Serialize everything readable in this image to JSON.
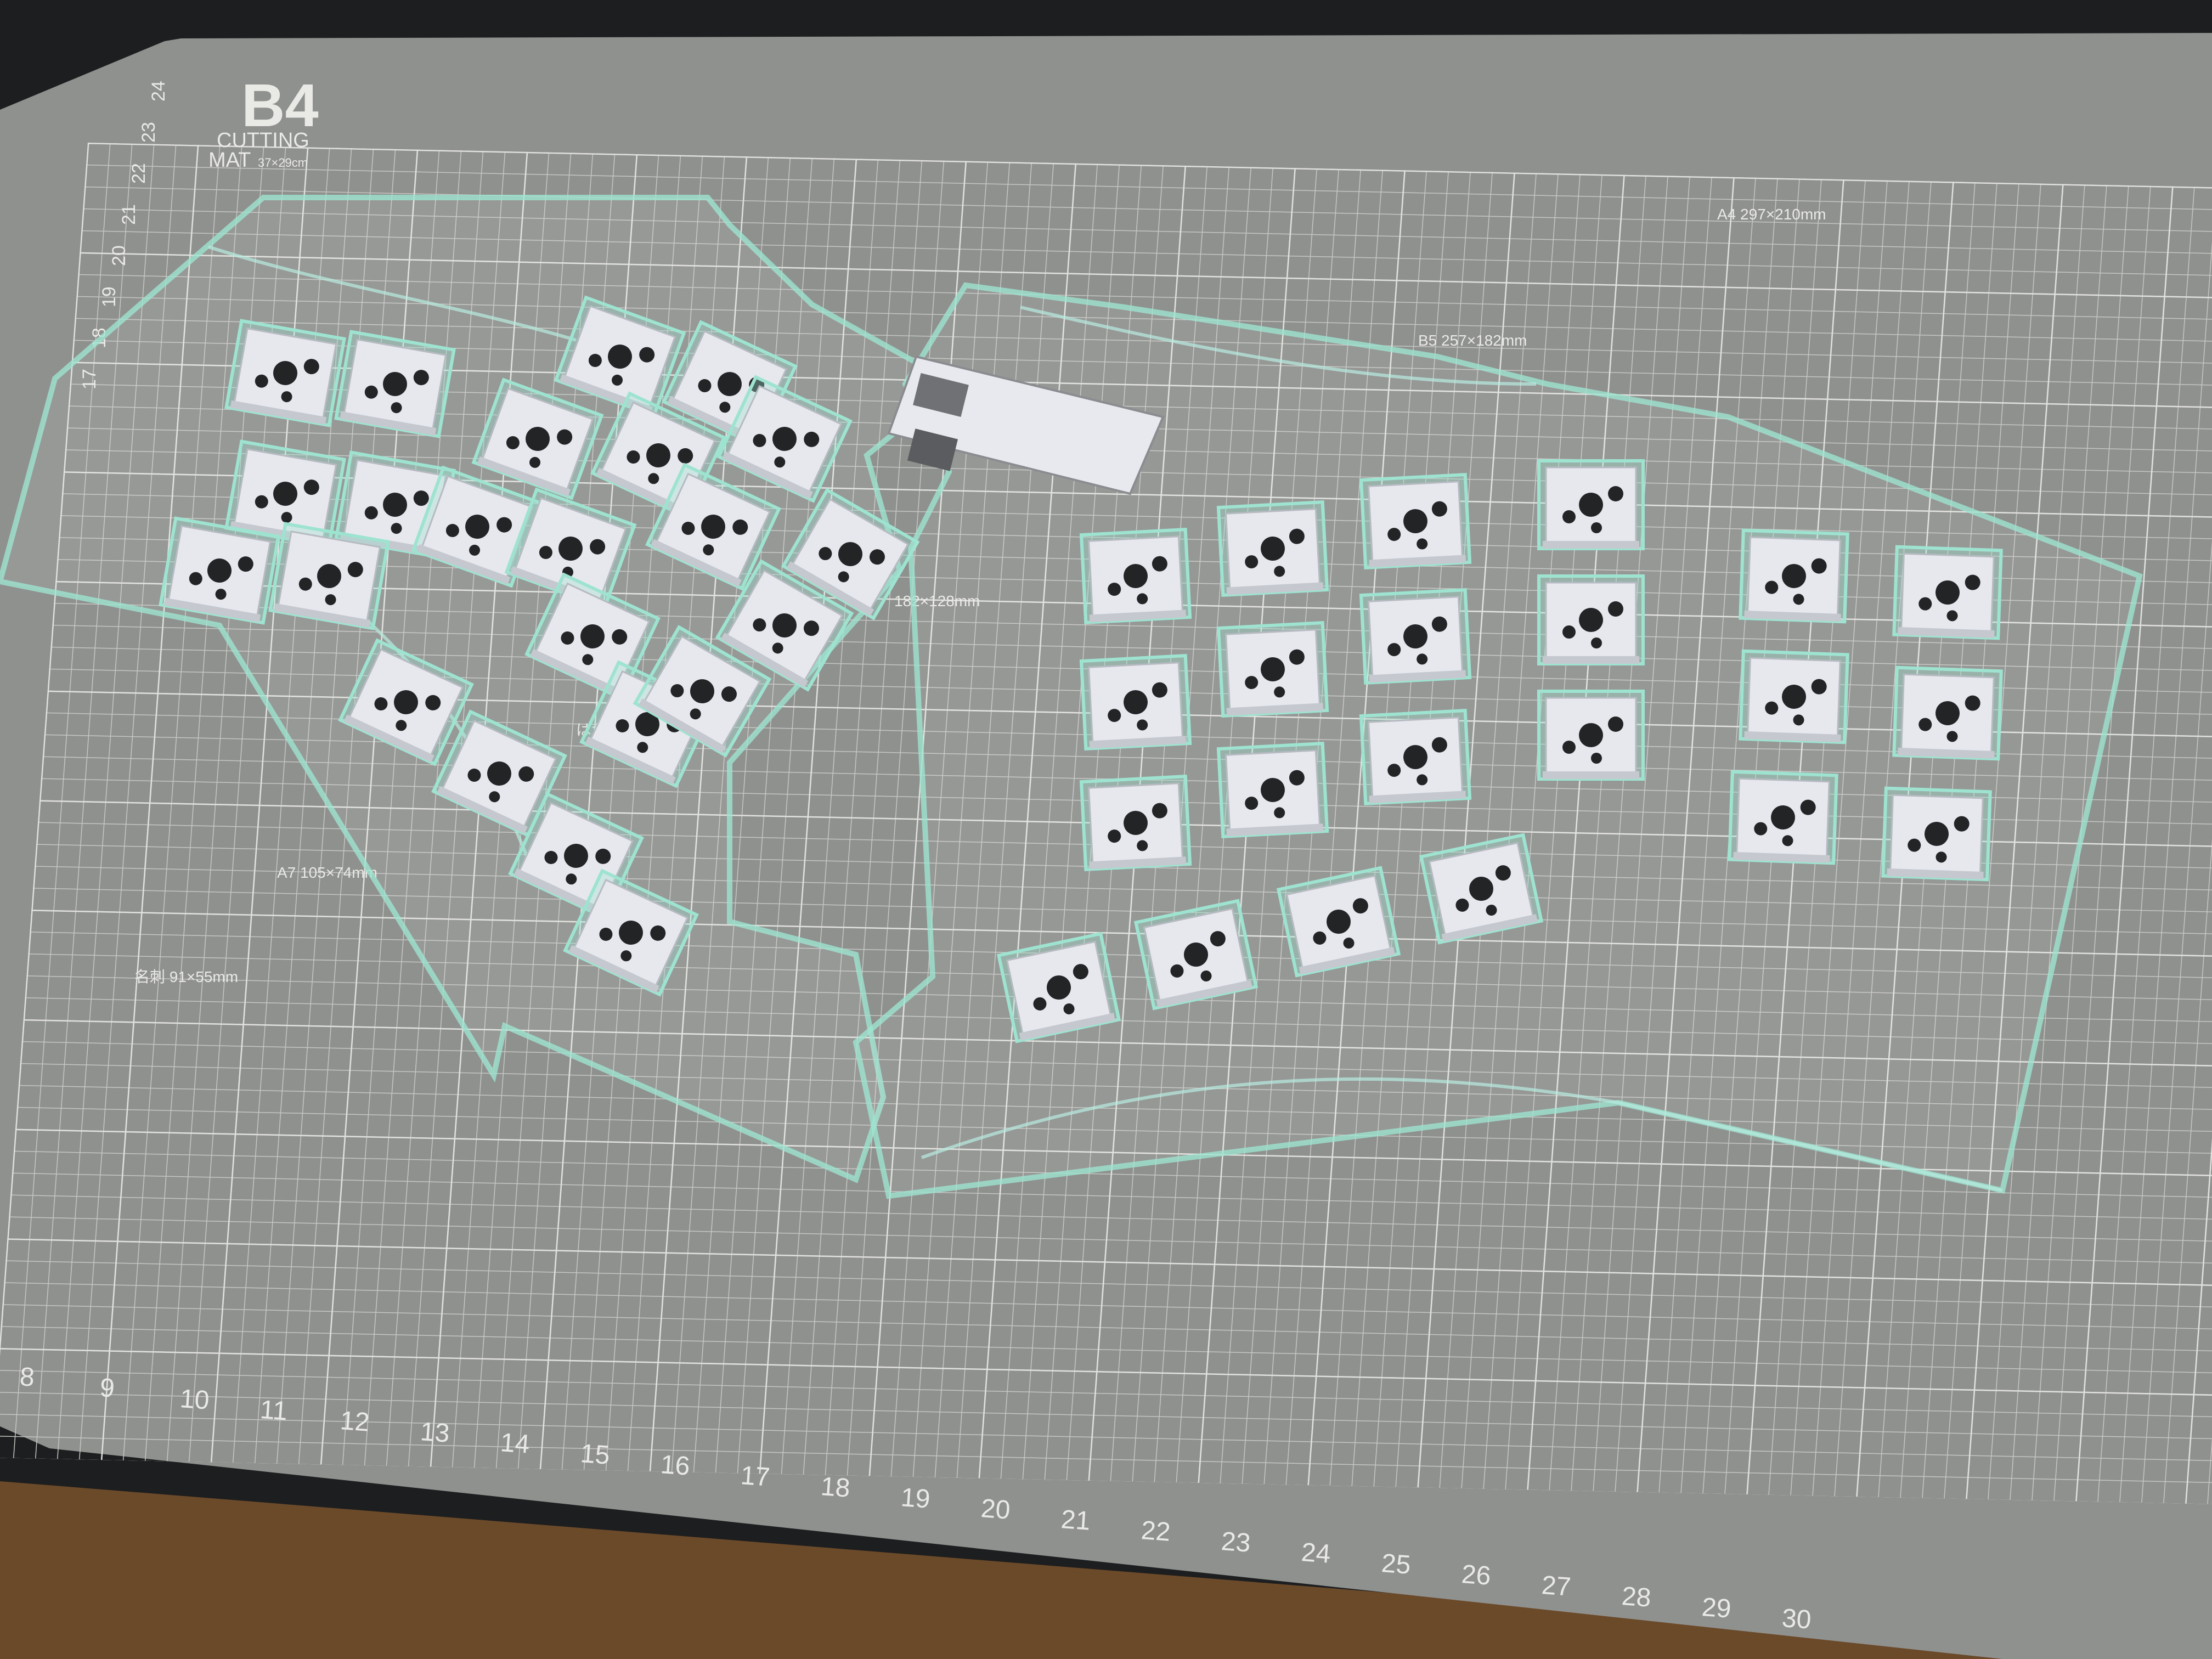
{
  "mat": {
    "brand": "B4",
    "product": "CUTTING",
    "product2": "MAT",
    "size_note": "37×29cm",
    "zones": {
      "a4": "A4 297×210mm",
      "b5": "B5 257×182mm",
      "a6": "182×128mm",
      "postcard": "はがき",
      "a7": "A7 105×74mm",
      "card": "名刺 91×55mm"
    },
    "ruler_bottom": [
      "8",
      "9",
      "10",
      "11",
      "12",
      "13",
      "14",
      "15",
      "16",
      "17",
      "18",
      "19",
      "20",
      "21",
      "22",
      "23",
      "24",
      "25",
      "26",
      "27",
      "28",
      "29",
      "30"
    ],
    "ruler_left": [
      "24",
      "23",
      "22",
      "21",
      "20",
      "19",
      "18",
      "17"
    ]
  },
  "colors": {
    "mat": "#8f918f",
    "grid": "#c6c7c3",
    "acrylic_edge": "#9ee3d0",
    "plate": "#e6e8ee",
    "hole": "#222426",
    "desk": "#6b4a2a"
  }
}
